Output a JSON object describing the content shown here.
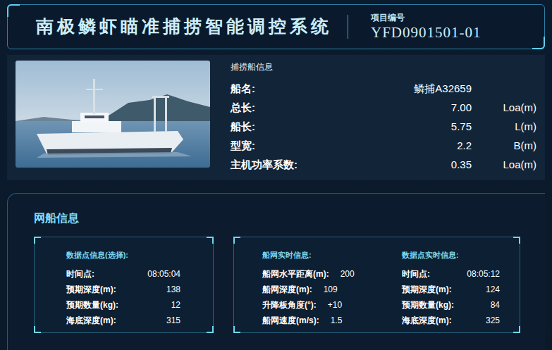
{
  "header": {
    "title": "南极鳞虾瞄准捕捞智能调控系统",
    "project_label": "项目编号",
    "project_code": "YFD0901501-01"
  },
  "vessel": {
    "title": "捕捞船信息",
    "rows": [
      {
        "label": "船名:",
        "value": "鳞捕A32659"
      },
      {
        "label": "总长:",
        "value": "7.00",
        "unit": "Loa(m)"
      },
      {
        "label": "船长:",
        "value": "5.75",
        "unit": "L(m)"
      },
      {
        "label": "型宽:",
        "value": "2.2",
        "unit": "B(m)"
      },
      {
        "label": "主机功率系数:",
        "value": "0.35",
        "unit": "Loa(m)"
      }
    ]
  },
  "net": {
    "title": "网船信息",
    "selected_point": {
      "title": "数据点信息(选择):",
      "rows": [
        {
          "label": "时间点:",
          "value": "08:05:04"
        },
        {
          "label": "预期深度(m):",
          "value": "138"
        },
        {
          "label": "预期数量(kg):",
          "value": "12"
        },
        {
          "label": "海底深度(m):",
          "value": "315"
        }
      ]
    },
    "net_realtime": {
      "title": "船网实时信息:",
      "rows": [
        {
          "label": "船网水平距离(m):",
          "value": "200"
        },
        {
          "label": "船网深度(m):",
          "value": "109"
        },
        {
          "label": "升降板角度(°):",
          "value": "+10"
        },
        {
          "label": "船网速度(m/s):",
          "value": "1.5"
        }
      ]
    },
    "point_realtime": {
      "title": "数据点实时信息:",
      "rows": [
        {
          "label": "时间点:",
          "value": "08:05:12"
        },
        {
          "label": "预期深度(m):",
          "value": "124"
        },
        {
          "label": "预期数量(kg):",
          "value": "84"
        },
        {
          "label": "海底深度(m):",
          "value": "325"
        }
      ]
    }
  }
}
